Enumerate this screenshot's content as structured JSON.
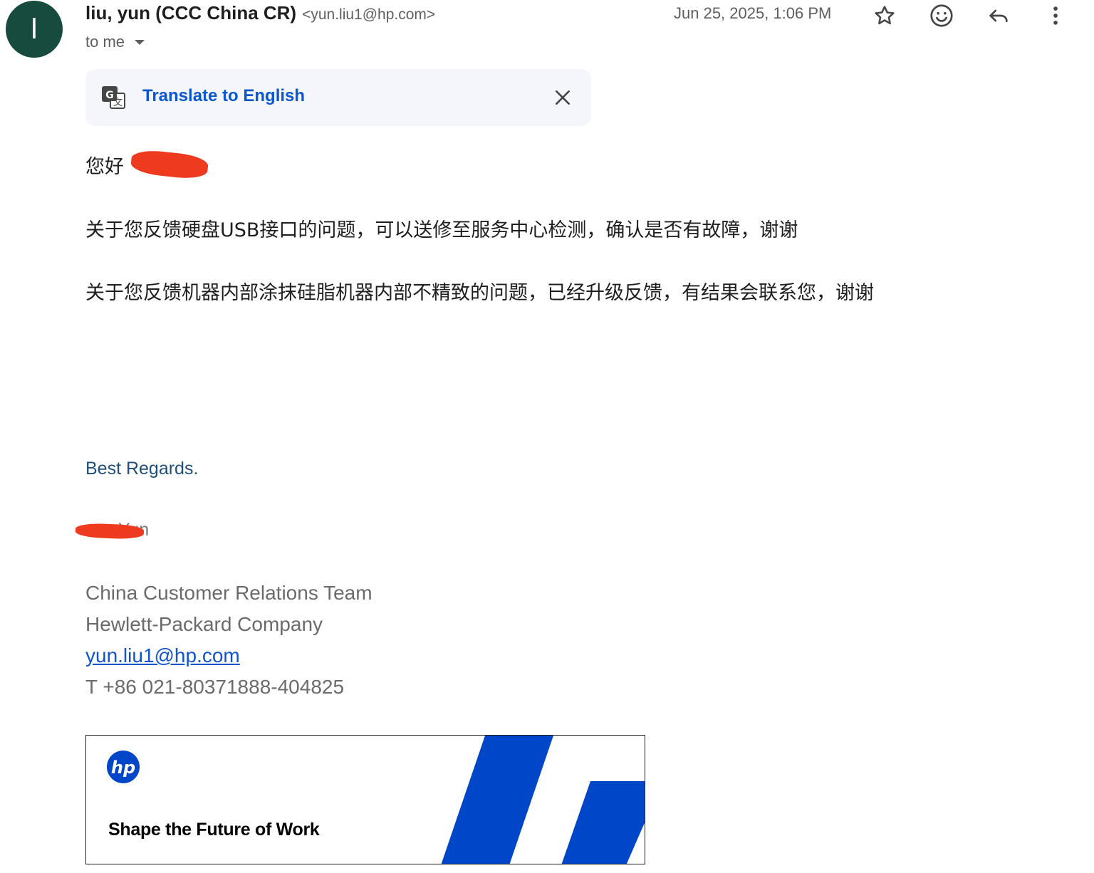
{
  "header": {
    "avatar_initial": "l",
    "sender_name": "liu, yun (CCC China CR)",
    "sender_email": "<yun.liu1@hp.com>",
    "recipient": "to me",
    "date": "Jun 25, 2025, 1:06 PM",
    "icons": [
      "star-icon",
      "emoji-icon",
      "reply-icon",
      "more-vert-icon"
    ]
  },
  "translate": {
    "label": "Translate to English",
    "icon": "translate-icon",
    "close_icon": "close-icon"
  },
  "body": {
    "greeting": "您好",
    "line1": "关于您反馈硬盘USB接口的问题，可以送修至服务中心检测，确认是否有故障，谢谢",
    "line2": "关于您反馈机器内部涂抹硅脂机器内部不精致的问题，已经升级反馈，有结果会联系您，谢谢"
  },
  "signature": {
    "regards": "Best Regards.",
    "name_partial": "Yun",
    "team": "China Customer Relations Team",
    "company": "Hewlett-Packard Company",
    "email": "yun.liu1@hp.com",
    "phone": "T +86 021-80371888-404825"
  },
  "banner": {
    "logo": "hp-logo",
    "tagline": "Shape the Future of Work",
    "accent_color": "#0046c8"
  },
  "colors": {
    "avatar_bg": "#174b3d",
    "link_blue": "#0b57d0",
    "redaction": "#ee3a1f"
  }
}
